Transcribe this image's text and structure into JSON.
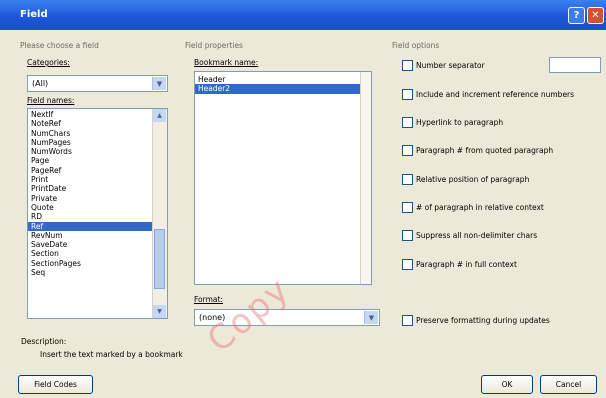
{
  "window": {
    "title": "Field",
    "help_glyph": "?",
    "close_glyph": "✕"
  },
  "left": {
    "section_title": "Please choose a field",
    "categories_label": "Categories:",
    "categories_value": "(All)",
    "field_names_label": "Field names:",
    "field_names": [
      "NextIf",
      "NoteRef",
      "NumChars",
      "NumPages",
      "NumWords",
      "Page",
      "PageRef",
      "Print",
      "PrintDate",
      "Private",
      "Quote",
      "RD",
      "Ref",
      "RevNum",
      "SaveDate",
      "Section",
      "SectionPages",
      "Seq"
    ],
    "selected_field": "Ref"
  },
  "middle": {
    "section_title": "Field properties",
    "bookmark_label": "Bookmark name:",
    "bookmarks": [
      "Header",
      "Header2"
    ],
    "selected_bookmark": "Header2",
    "format_label": "Format:",
    "format_value": "(none)"
  },
  "right": {
    "section_title": "Field options",
    "options": [
      "Number separator",
      "Include and increment reference numbers",
      "Hyperlink to paragraph",
      "Paragraph # from quoted paragraph",
      "Relative position of paragraph",
      "# of paragraph in relative context",
      "Suppress all non-delimiter chars",
      "Paragraph # in full context",
      "Preserve formatting during updates"
    ]
  },
  "description": {
    "label": "Description:",
    "text": "Insert the text marked by a bookmark"
  },
  "buttons": {
    "field_codes": "Field Codes",
    "ok": "OK",
    "cancel": "Cancel"
  },
  "watermark": "Copy"
}
